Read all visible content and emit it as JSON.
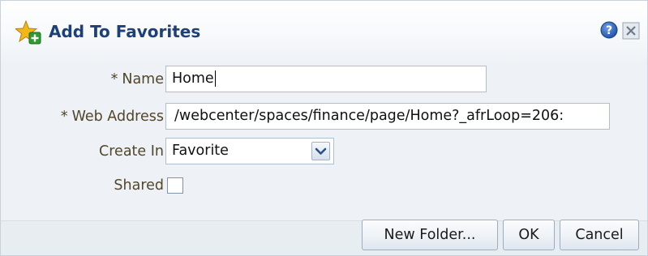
{
  "dialog": {
    "title": "Add To Favorites",
    "icons": {
      "title": "star-add-icon",
      "help": "help-icon",
      "close": "close-icon"
    }
  },
  "form": {
    "name": {
      "required_marker": "*",
      "label": "Name",
      "value": "Home"
    },
    "web_address": {
      "required_marker": "*",
      "label": "Web Address",
      "value": "/webcenter/spaces/finance/page/Home?_afrLoop=206:"
    },
    "create_in": {
      "label": "Create In",
      "selected": "Favorite"
    },
    "shared": {
      "label": "Shared",
      "checked": false
    }
  },
  "buttons": {
    "new_folder": "New Folder...",
    "ok": "OK",
    "cancel": "Cancel"
  },
  "colors": {
    "title_text": "#1d4079",
    "label_text": "#51462a",
    "input_border": "#aebfd1",
    "panel_bg": "#eef2f6"
  }
}
